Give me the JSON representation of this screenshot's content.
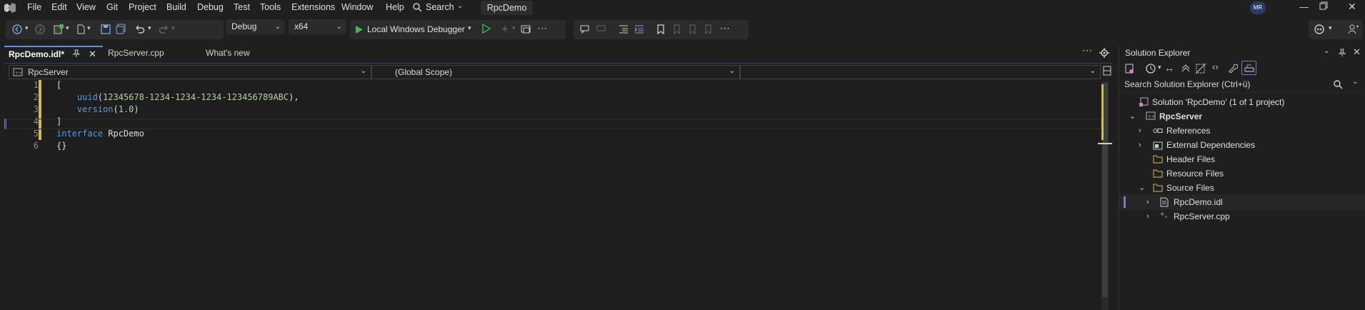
{
  "menu": {
    "items": [
      "File",
      "Edit",
      "View",
      "Git",
      "Project",
      "Build",
      "Debug",
      "Test",
      "Tools",
      "Extensions",
      "Window",
      "Help"
    ],
    "search_label": "Search",
    "solution_name": "RpcDemo",
    "avatar_initials": "MR"
  },
  "toolbar": {
    "configuration": "Debug",
    "platform": "x64",
    "debugger_label": "Local Windows Debugger"
  },
  "tabs": [
    {
      "label": "RpcDemo.idl*",
      "active": true
    },
    {
      "label": "RpcServer.cpp",
      "active": false
    },
    {
      "label": "What's new",
      "active": false
    }
  ],
  "navbar": {
    "project": "RpcServer",
    "scope": "(Global Scope)",
    "member": ""
  },
  "editor": {
    "line_numbers": [
      "1",
      "2",
      "3",
      "4",
      "5",
      "6"
    ],
    "lines": [
      {
        "segments": [
          {
            "t": "[",
            "c": "punc"
          }
        ]
      },
      {
        "segments": [
          {
            "t": "    uuid",
            "c": "fn"
          },
          {
            "t": "(",
            "c": "punc"
          },
          {
            "t": "12345678-1234-1234-1234-123456789ABC",
            "c": "num"
          },
          {
            "t": "),",
            "c": "punc"
          }
        ]
      },
      {
        "segments": [
          {
            "t": "    version",
            "c": "fn"
          },
          {
            "t": "(",
            "c": "punc"
          },
          {
            "t": "1.0",
            "c": "num"
          },
          {
            "t": ")",
            "c": "punc"
          }
        ]
      },
      {
        "segments": [
          {
            "t": "]",
            "c": "punc"
          }
        ]
      },
      {
        "segments": [
          {
            "t": "interface",
            "c": "kw"
          },
          {
            "t": " RpcDemo",
            "c": "ident"
          }
        ]
      },
      {
        "segments": [
          {
            "t": "{}",
            "c": "punc"
          }
        ]
      }
    ]
  },
  "solution_explorer": {
    "title": "Solution Explorer",
    "search_placeholder": "Search Solution Explorer (Ctrl+ü)",
    "solution_label": "Solution 'RpcDemo' (1 of 1 project)",
    "project_label": "RpcServer",
    "nodes": {
      "references": "References",
      "external_dependencies": "External Dependencies",
      "header_files": "Header Files",
      "resource_files": "Resource Files",
      "source_files": "Source Files",
      "rpcdemo_idl": "RpcDemo.idl",
      "rpcserver_cpp": "RpcServer.cpp"
    }
  },
  "colors": {
    "background": "#1f1f1f",
    "accent": "#6e8bd6",
    "keyword": "#569cd6",
    "number": "#b5cea8",
    "run_green": "#3fb950"
  }
}
